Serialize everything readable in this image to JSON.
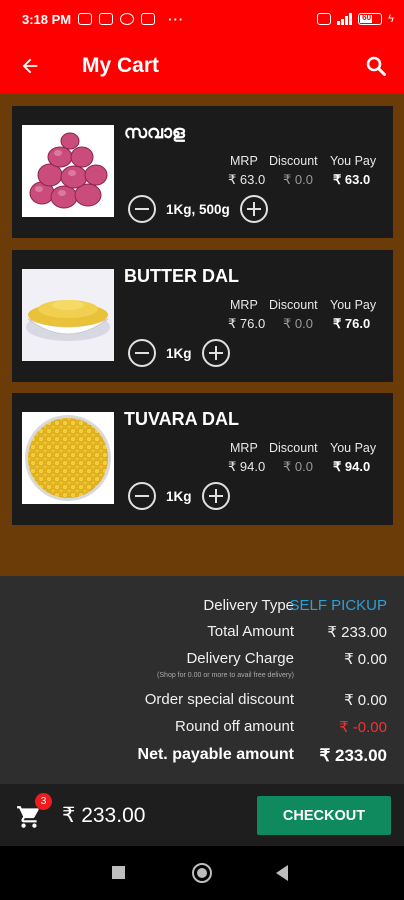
{
  "status_bar": {
    "time": "3:18 PM",
    "more": "···",
    "battery_level": 0.6,
    "battery_label": "60"
  },
  "app_bar": {
    "title": "My Cart",
    "back_icon": "arrow-left-icon",
    "search_icon": "search-icon"
  },
  "price_headers": {
    "mrp": "MRP",
    "discount": "Discount",
    "you_pay": "You Pay"
  },
  "items": [
    {
      "name": "സവാള",
      "mrp": "₹ 63.0",
      "discount": "₹ 0.0",
      "you_pay": "₹ 63.0",
      "quantity": "1Kg, 500g",
      "image": "onions"
    },
    {
      "name": "BUTTER DAL",
      "mrp": "₹ 76.0",
      "discount": "₹ 0.0",
      "you_pay": "₹ 76.0",
      "quantity": "1Kg",
      "image": "butter-dal"
    },
    {
      "name": "TUVARA DAL",
      "mrp": "₹ 94.0",
      "discount": "₹ 0.0",
      "you_pay": "₹ 94.0",
      "quantity": "1Kg",
      "image": "tuvara-dal"
    }
  ],
  "summary": {
    "delivery_type_label": "Delivery Type",
    "delivery_type_value": "SELF PICKUP",
    "total_label": "Total Amount",
    "total_value": "₹ 233.00",
    "delivery_charge_label": "Delivery Charge",
    "delivery_charge_value": "₹ 0.00",
    "delivery_note": "(Shop for 0.00 or more to avail free delivery)",
    "special_discount_label": "Order special discount",
    "special_discount_value": "₹ 0.00",
    "round_off_label": "Round off amount",
    "round_off_value": "₹ -0.00",
    "net_label": "Net. payable amount",
    "net_value": "₹ 233.00"
  },
  "bottom_bar": {
    "cart_count": "3",
    "total": "₹ 233.00",
    "checkout_label": "CHECKOUT"
  },
  "colors": {
    "primary": "#ff0000",
    "content_bg": "#6b3b08",
    "card_bg": "#1b1b1b",
    "checkout": "#0f8a5f",
    "link": "#2f9fd8",
    "negative": "#ee3333"
  }
}
